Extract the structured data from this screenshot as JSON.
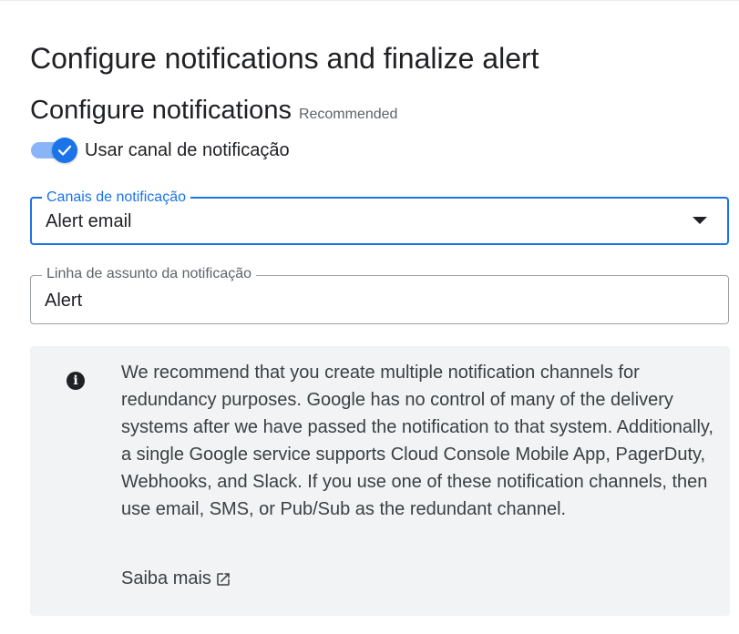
{
  "page": {
    "title": "Configure notifications and finalize alert"
  },
  "notifications": {
    "heading": "Configure notifications",
    "badge": "Recommended",
    "toggle": {
      "label": "Usar canal de notificação",
      "state": "on"
    },
    "channels_field": {
      "label": "Canais de notificação",
      "value": "Alert email"
    },
    "subject_field": {
      "label": "Linha de assunto da notificação",
      "value": "Alert"
    }
  },
  "info_box": {
    "icon": "info-icon",
    "text": "We recommend that you create multiple notification channels for redundancy purposes. Google has no control of many of the delivery systems after we have passed the notification to that system. Additionally, a single Google service supports Cloud Console Mobile App, PagerDuty, Webhooks, and Slack. If you use one of these notification channels, then use email, SMS, or Pub/Sub as the redundant channel.",
    "link_label": "Saiba mais",
    "link_icon": "open-in-new-icon"
  },
  "colors": {
    "accent": "#1a73e8",
    "toggle_track": "#8ab4f8",
    "info_background": "#f1f3f4"
  }
}
